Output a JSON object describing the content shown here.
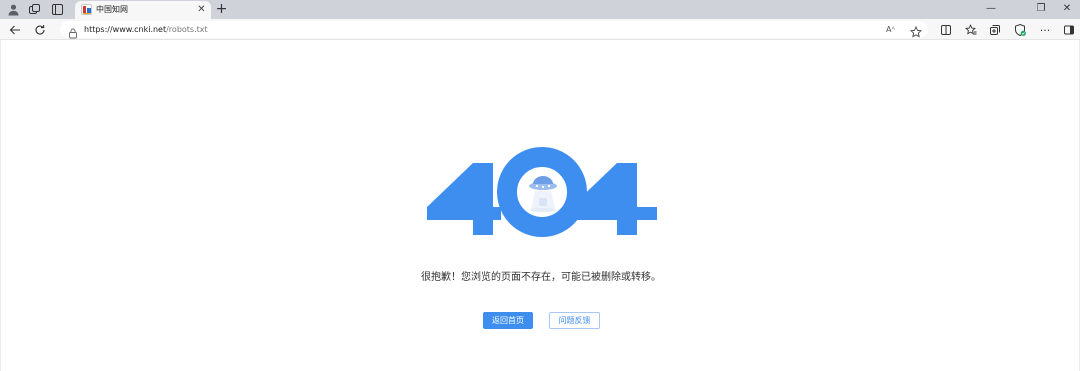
{
  "browser": {
    "tab": {
      "title": "中国知网",
      "close": "✕"
    },
    "new_tab": "+",
    "address": {
      "host": "https://www.cnki.net",
      "path": "/robots.txt"
    },
    "read_aloud": "Aᴬ",
    "more": "···",
    "window": {
      "minimize": "—",
      "restore": "❐",
      "close": "✕"
    }
  },
  "error_page": {
    "code": "404",
    "message": "很抱歉！您浏览的页面不存在，可能已被删除或转移。",
    "home_button": "返回首页",
    "feedback_button": "问题反馈",
    "accent_color": "#3e8ef0"
  }
}
